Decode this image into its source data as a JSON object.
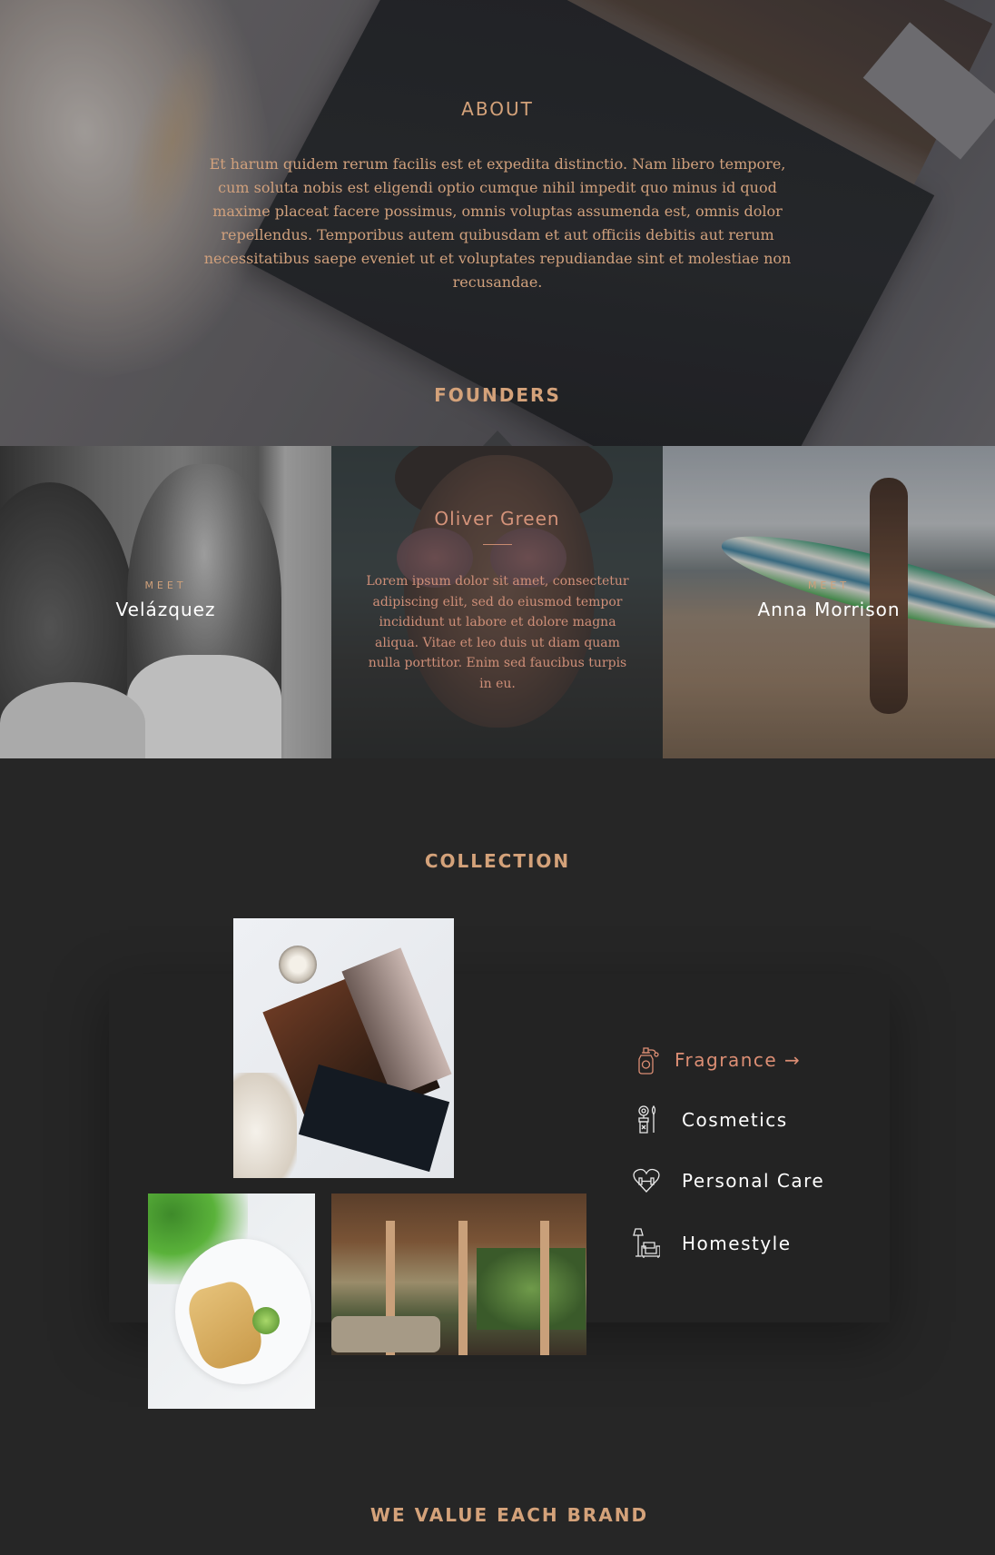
{
  "about": {
    "title": "ABOUT",
    "text": "Et harum quidem rerum facilis est et expedita distinctio. Nam libero tempore, cum soluta nobis est eligendi optio cumque nihil impedit quo minus id quod maxime placeat facere possimus, omnis voluptas assumenda est, omnis dolor repellendus. Temporibus autem quibusdam et aut officiis debitis aut rerum necessitatibus saepe eveniet ut et voluptates repudiandae sint et molestiae non recusandae."
  },
  "founders": {
    "title": "FOUNDERS",
    "people": [
      {
        "meet_label": "MEET",
        "name": "Velázquez"
      },
      {
        "name": "Oliver Green",
        "bio": "Lorem ipsum dolor sit amet, consectetur adipiscing elit, sed do eiusmod tempor incididunt ut labore et dolore magna aliqua. Vitae et leo duis ut diam quam nulla porttitor. Enim sed faucibus turpis in eu."
      },
      {
        "meet_label": "MEET",
        "name": "Anna Morrison"
      }
    ]
  },
  "collection": {
    "title": "COLLECTION",
    "categories": [
      {
        "label": "Fragrance →",
        "icon": "perfume-bottle-icon",
        "active": true
      },
      {
        "label": "Cosmetics",
        "icon": "makeup-brushes-icon",
        "active": false
      },
      {
        "label": "Personal Care",
        "icon": "heart-dumbbell-icon",
        "active": false
      },
      {
        "label": "Homestyle",
        "icon": "lamp-armchair-icon",
        "active": false
      }
    ]
  },
  "brand": {
    "title": "WE VALUE EACH BRAND"
  },
  "colors": {
    "accent": "#d4a27a",
    "active": "#dc8e74",
    "background": "#262626"
  }
}
